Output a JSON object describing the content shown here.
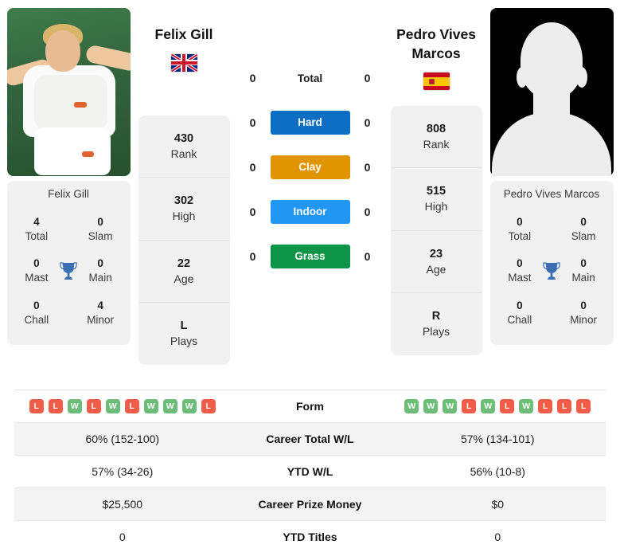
{
  "players": {
    "left": {
      "name": "Felix Gill",
      "photo_caption": "Felix Gill",
      "flag": "uk-flag",
      "stats": [
        {
          "value": "430",
          "label": "Rank"
        },
        {
          "value": "302",
          "label": "High"
        },
        {
          "value": "22",
          "label": "Age"
        },
        {
          "value": "L",
          "label": "Plays"
        }
      ],
      "titles": {
        "total": "4",
        "total_label": "Total",
        "slam": "0",
        "slam_label": "Slam",
        "mast": "0",
        "mast_label": "Mast",
        "main": "0",
        "main_label": "Main",
        "chall": "0",
        "chall_label": "Chall",
        "minor": "4",
        "minor_label": "Minor"
      },
      "form": [
        "L",
        "L",
        "W",
        "L",
        "W",
        "L",
        "W",
        "W",
        "W",
        "L"
      ],
      "career_wl": "60% (152-100)",
      "ytd_wl": "57% (34-26)",
      "prize": "$25,500",
      "ytd_titles": "0"
    },
    "right": {
      "name": "Pedro Vives Marcos",
      "photo_caption": "Pedro Vives Marcos",
      "flag": "spain-flag",
      "stats": [
        {
          "value": "808",
          "label": "Rank"
        },
        {
          "value": "515",
          "label": "High"
        },
        {
          "value": "23",
          "label": "Age"
        },
        {
          "value": "R",
          "label": "Plays"
        }
      ],
      "titles": {
        "total": "0",
        "total_label": "Total",
        "slam": "0",
        "slam_label": "Slam",
        "mast": "0",
        "mast_label": "Mast",
        "main": "0",
        "main_label": "Main",
        "chall": "0",
        "chall_label": "Chall",
        "minor": "0",
        "minor_label": "Minor"
      },
      "form": [
        "W",
        "W",
        "W",
        "L",
        "W",
        "L",
        "W",
        "L",
        "L",
        "L"
      ],
      "career_wl": "57% (134-101)",
      "ytd_wl": "56% (10-8)",
      "prize": "$0",
      "ytd_titles": "0"
    }
  },
  "h2h": [
    {
      "left": "0",
      "label": "Total",
      "right": "0",
      "type": "plain",
      "color": ""
    },
    {
      "left": "0",
      "label": "Hard",
      "right": "0",
      "type": "badge",
      "color": "#0d6fc4"
    },
    {
      "left": "0",
      "label": "Clay",
      "right": "0",
      "type": "badge",
      "color": "#e09500"
    },
    {
      "left": "0",
      "label": "Indoor",
      "right": "0",
      "type": "badge",
      "color": "#2196f3"
    },
    {
      "left": "0",
      "label": "Grass",
      "right": "0",
      "type": "badge",
      "color": "#0e9447"
    }
  ],
  "table_rows": [
    {
      "label": "Form",
      "kind": "form"
    },
    {
      "label": "Career Total W/L",
      "kind": "text",
      "left": "60% (152-100)",
      "right": "57% (134-101)"
    },
    {
      "label": "YTD W/L",
      "kind": "text",
      "left": "57% (34-26)",
      "right": "56% (10-8)"
    },
    {
      "label": "Career Prize Money",
      "kind": "text",
      "left": "$25,500",
      "right": "$0"
    },
    {
      "label": "YTD Titles",
      "kind": "text",
      "left": "0",
      "right": "0"
    }
  ],
  "colors": {
    "hard": "#0d6fc4",
    "clay": "#e09500",
    "indoor": "#2196f3",
    "grass": "#0e9447",
    "win": "#6dbd78",
    "loss": "#ef5d48",
    "trophy": "#3c6eb4",
    "card_bg": "#f1f1f1",
    "row_alt": "#f4f4f4"
  }
}
